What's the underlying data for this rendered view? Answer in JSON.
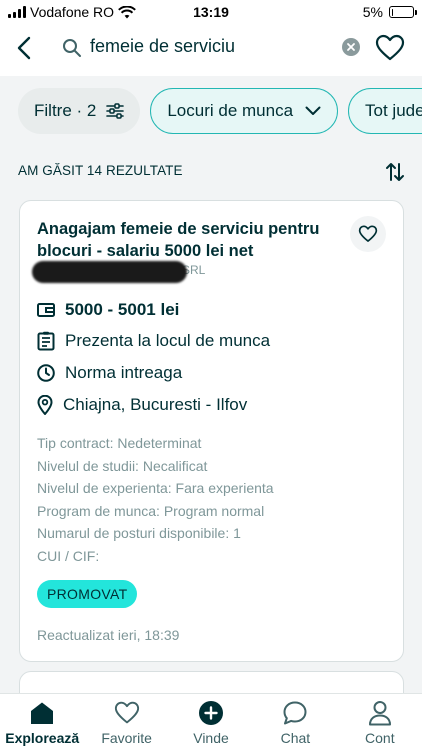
{
  "status_bar": {
    "carrier": "Vodafone RO",
    "time": "13:19",
    "battery_percent": "5%",
    "battery_level": 0.05
  },
  "search": {
    "query": "femeie de serviciu"
  },
  "filters": {
    "chips": [
      {
        "label": "Filtre · 2",
        "icon": "sliders-icon"
      },
      {
        "label": "Locuri de munca",
        "icon": "chevron-down-icon"
      },
      {
        "label": "Tot județul",
        "icon": ""
      }
    ]
  },
  "results": {
    "count_label": "AM GĂSIT 14 REZULTATE"
  },
  "listing": {
    "title": "Anagajam femeie de serviciu pentru blocuri - salariu 5000 lei net",
    "company": "LINE SRL",
    "salary": "5000 - 5001 lei",
    "work_mode": "Prezenta la locul de munca",
    "schedule": "Norma intreaga",
    "location": "Chiajna, Bucuresti - Ilfov",
    "details": [
      "Tip contract: Nedeterminat",
      "Nivelul de studii: Necalificat",
      "Nivelul de experienta: Fara experienta",
      "Program de munca: Program normal",
      "Numarul de posturi disponibile: 1",
      "CUI / CIF:"
    ],
    "badge": "PROMOVAT",
    "updated": "Reactualizat ieri, 18:39"
  },
  "bottom_nav": {
    "items": [
      {
        "label": "Explorează",
        "icon": "home-icon",
        "active": true
      },
      {
        "label": "Favorite",
        "icon": "heart-icon",
        "active": false
      },
      {
        "label": "Vinde",
        "icon": "plus-circle-icon",
        "active": false
      },
      {
        "label": "Chat",
        "icon": "chat-icon",
        "active": false
      },
      {
        "label": "Cont",
        "icon": "user-icon",
        "active": false
      }
    ]
  },
  "colors": {
    "primary": "#002f34",
    "accent": "#23e5db",
    "accent_border": "#23b7b3",
    "muted": "#7f9799",
    "background": "#f2f4f5"
  }
}
